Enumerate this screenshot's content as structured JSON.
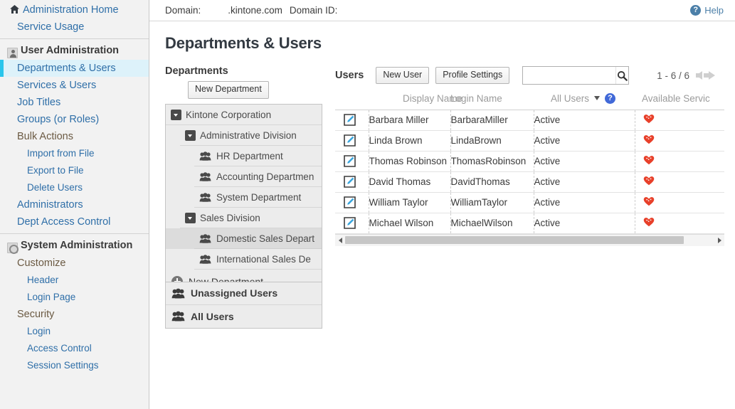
{
  "sidebar": {
    "home": {
      "label": "Administration Home",
      "icon": "home-icon"
    },
    "service_usage": "Service Usage",
    "user_admin": {
      "title": "User Administration",
      "icon": "person-icon",
      "items": [
        {
          "label": "Departments & Users",
          "level": 1,
          "selected": true
        },
        {
          "label": "Services & Users",
          "level": 1,
          "selected": false
        },
        {
          "label": "Job Titles",
          "level": 1,
          "selected": false
        },
        {
          "label": "Groups (or Roles)",
          "level": 1,
          "selected": false
        },
        {
          "label": "Bulk Actions",
          "level": 1,
          "selected": false,
          "plain": true
        },
        {
          "label": "Import from File",
          "level": 2,
          "selected": false
        },
        {
          "label": "Export to File",
          "level": 2,
          "selected": false
        },
        {
          "label": "Delete Users",
          "level": 2,
          "selected": false
        },
        {
          "label": "Administrators",
          "level": 1,
          "selected": false
        },
        {
          "label": "Dept Access Control",
          "level": 1,
          "selected": false
        }
      ]
    },
    "system_admin": {
      "title": "System Administration",
      "icon": "gear-icon",
      "items": [
        {
          "label": "Customize",
          "level": 1,
          "plain": true
        },
        {
          "label": "Header",
          "level": 2
        },
        {
          "label": "Login Page",
          "level": 2
        },
        {
          "label": "Security",
          "level": 1,
          "plain": true
        },
        {
          "label": "Login",
          "level": 2
        },
        {
          "label": "Access Control",
          "level": 2
        },
        {
          "label": "Session Settings",
          "level": 2
        }
      ]
    }
  },
  "topbar": {
    "domain_label": "Domain:",
    "domain_value": ".kintone.com",
    "domain_id_label": "Domain ID:",
    "domain_id_value": "",
    "help_label": "Help",
    "help_icon": "question-mark-icon"
  },
  "page": {
    "title": "Departments & Users"
  },
  "departments": {
    "heading": "Departments",
    "new_department_button": "New Department",
    "tree": [
      {
        "label": "Kintone Corporation",
        "depth": 0,
        "icon": "caret-down-icon",
        "selected": false
      },
      {
        "label": "Administrative Division",
        "depth": 1,
        "icon": "caret-down-icon",
        "selected": false
      },
      {
        "label": "HR Department",
        "depth": 2,
        "icon": "group-icon",
        "selected": false
      },
      {
        "label": "Accounting Departmen",
        "depth": 2,
        "icon": "group-icon",
        "selected": false
      },
      {
        "label": "System Department",
        "depth": 2,
        "icon": "group-icon",
        "selected": false
      },
      {
        "label": "Sales Division",
        "depth": 1,
        "icon": "caret-down-icon",
        "selected": false
      },
      {
        "label": "Domestic Sales Depart",
        "depth": 2,
        "icon": "group-icon",
        "selected": true
      },
      {
        "label": "International Sales De",
        "depth": 2,
        "icon": "group-icon",
        "selected": false
      }
    ],
    "add_row": {
      "label": "New Department",
      "icon": "plus-circle-icon"
    },
    "footer": [
      {
        "label": "Unassigned Users",
        "icon": "group-icon"
      },
      {
        "label": "All Users",
        "icon": "group-icon"
      }
    ]
  },
  "users": {
    "heading": "Users",
    "new_user_button": "New User",
    "profile_settings_button": "Profile Settings",
    "search": {
      "value": "",
      "placeholder": "",
      "icon": "search-icon"
    },
    "pager": {
      "range": "1 - 6 / 6",
      "prev_icon": "arrow-left-icon",
      "next_icon": "arrow-right-icon"
    },
    "columns": {
      "edit": "",
      "display_name": "Display Name",
      "login_name": "Login Name",
      "status_filter": "All Users",
      "status_filter_icon": "chevron-down-icon",
      "help_badge_icon": "question-mark-icon",
      "available_services": "Available Servic"
    },
    "rows": [
      {
        "display_name": "Barbara Miller",
        "login_name": "BarbaraMiller",
        "status": "Active",
        "service_icon": "kintone-heart-icon",
        "edit_icon": "edit-pencil-icon"
      },
      {
        "display_name": "Linda Brown",
        "login_name": "LindaBrown",
        "status": "Active",
        "service_icon": "kintone-heart-icon",
        "edit_icon": "edit-pencil-icon"
      },
      {
        "display_name": "Thomas Robinson",
        "login_name": "ThomasRobinson",
        "status": "Active",
        "service_icon": "kintone-heart-icon",
        "edit_icon": "edit-pencil-icon"
      },
      {
        "display_name": "David Thomas",
        "login_name": "DavidThomas",
        "status": "Active",
        "service_icon": "kintone-heart-icon",
        "edit_icon": "edit-pencil-icon"
      },
      {
        "display_name": "William Taylor",
        "login_name": "WilliamTaylor",
        "status": "Active",
        "service_icon": "kintone-heart-icon",
        "edit_icon": "edit-pencil-icon"
      },
      {
        "display_name": "Michael Wilson",
        "login_name": "MichaelWilson",
        "status": "Active",
        "service_icon": "kintone-heart-icon",
        "edit_icon": "edit-pencil-icon"
      }
    ]
  },
  "colors": {
    "link": "#2f6fa8",
    "selected_nav_bg": "#ddf2fa",
    "selected_nav_accent": "#29c5ec",
    "sidebar_bg": "#f2f2f2",
    "service_icon": "#e8402a",
    "help_badge": "#4b7fa8",
    "info_badge": "#4169d8"
  }
}
